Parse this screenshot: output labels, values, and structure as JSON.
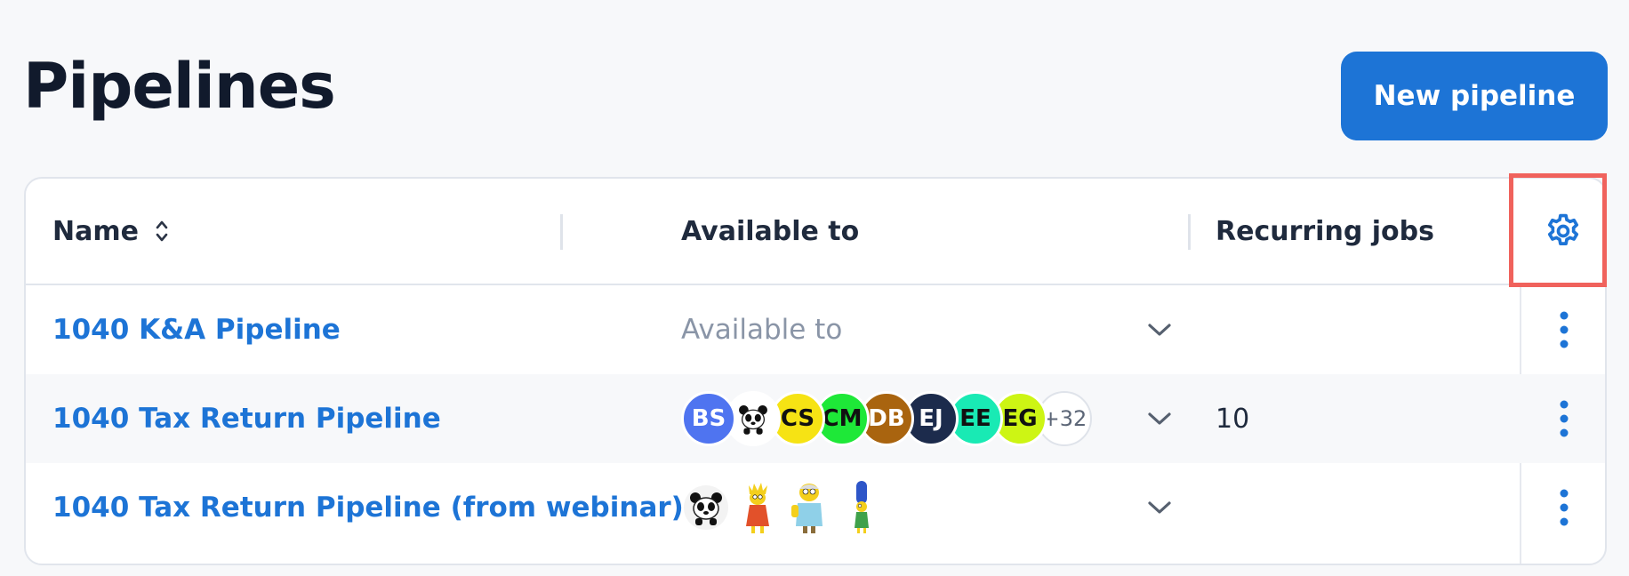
{
  "page": {
    "title": "Pipelines",
    "new_button_label": "New pipeline"
  },
  "table": {
    "columns": {
      "name": "Name",
      "available_to": "Available to",
      "recurring_jobs": "Recurring jobs"
    },
    "rows": [
      {
        "name": "1040 K&A Pipeline",
        "available_placeholder": "Available to",
        "recurring_jobs": ""
      },
      {
        "name": "1040 Tax Return Pipeline",
        "recurring_jobs": "10",
        "avatars": [
          {
            "initials": "BS",
            "bg": "#4f74f0",
            "fg": "#ffffff"
          },
          {
            "initials": "",
            "icon": "panda-icon",
            "bg": "#ffffff",
            "fg": "#000000"
          },
          {
            "initials": "CS",
            "bg": "#f6e314",
            "fg": "#111111"
          },
          {
            "initials": "CM",
            "bg": "#1ee838",
            "fg": "#111111"
          },
          {
            "initials": "DB",
            "bg": "#a9640f",
            "fg": "#ffffff"
          },
          {
            "initials": "EJ",
            "bg": "#1c2b4c",
            "fg": "#ffffff"
          },
          {
            "initials": "EE",
            "bg": "#19eab4",
            "fg": "#111111"
          },
          {
            "initials": "EG",
            "bg": "#cdf514",
            "fg": "#111111"
          }
        ],
        "more_count": "+32"
      },
      {
        "name": "1040 Tax Return Pipeline (from webinar)",
        "recurring_jobs": "",
        "avatar_icons": [
          "panda-icon",
          "lisa-simpson-icon",
          "grandpa-simpson-icon",
          "marge-simpson-icon"
        ]
      }
    ]
  },
  "colors": {
    "accent": "#1d74d6",
    "highlight": "#f0625c"
  }
}
